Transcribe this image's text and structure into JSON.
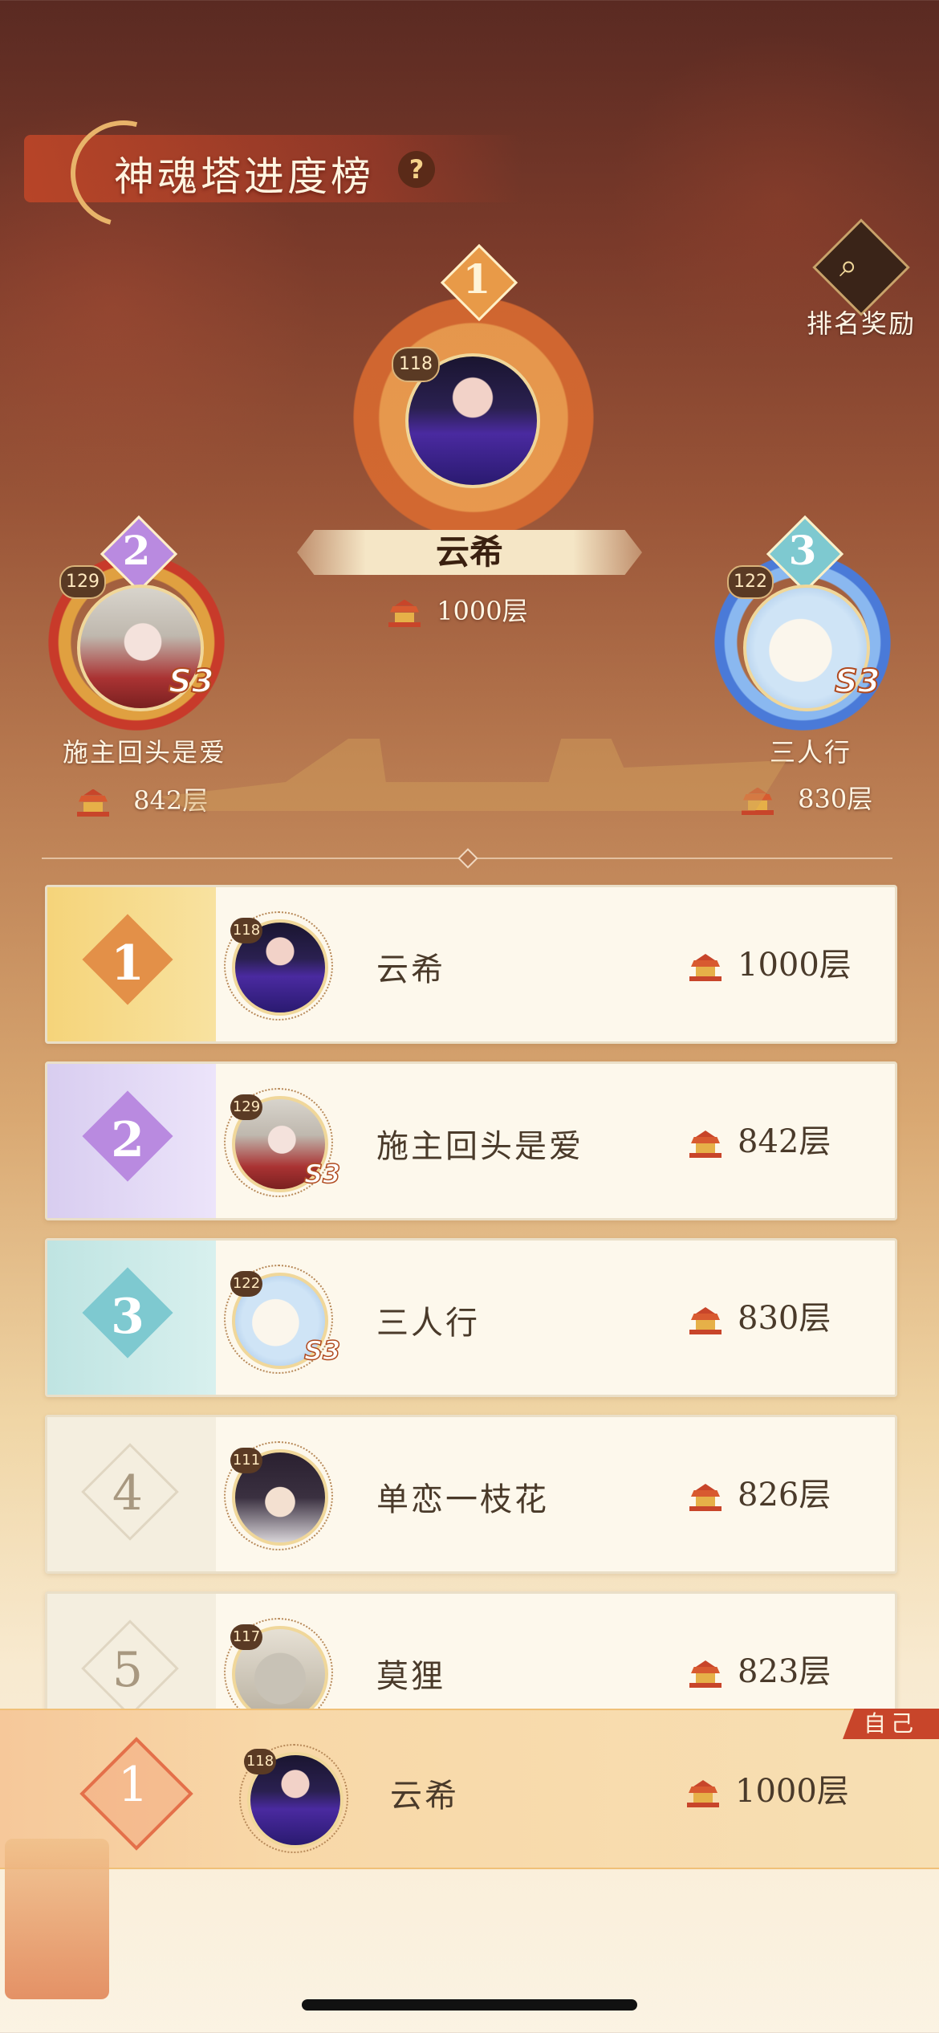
{
  "header": {
    "title": "神魂塔进度榜",
    "help_icon": "?",
    "rewards_label": "排名奖励"
  },
  "podium": [
    {
      "rank": "1",
      "name": "云希",
      "level": "118",
      "floor": "1000层",
      "badge": ""
    },
    {
      "rank": "2",
      "name": "施主回头是爱",
      "level": "129",
      "floor": "842层",
      "badge": "S3"
    },
    {
      "rank": "3",
      "name": "三人行",
      "level": "122",
      "floor": "830层",
      "badge": "S3"
    }
  ],
  "list": [
    {
      "rank": "1",
      "name": "云希",
      "level": "118",
      "floor": "1000层",
      "badge": ""
    },
    {
      "rank": "2",
      "name": "施主回头是爱",
      "level": "129",
      "floor": "842层",
      "badge": "S3"
    },
    {
      "rank": "3",
      "name": "三人行",
      "level": "122",
      "floor": "830层",
      "badge": "S3"
    },
    {
      "rank": "4",
      "name": "单恋一枝花",
      "level": "111",
      "floor": "826层",
      "badge": ""
    },
    {
      "rank": "5",
      "name": "莫狸",
      "level": "117",
      "floor": "823层",
      "badge": ""
    }
  ],
  "self": {
    "tag": "自己",
    "rank": "1",
    "name": "云希",
    "level": "118",
    "floor": "1000层"
  },
  "colors": {
    "rank1": "#e8a85a",
    "rank2": "#b98ae0",
    "rank3": "#7ec9d0",
    "accent": "#c8452a"
  }
}
